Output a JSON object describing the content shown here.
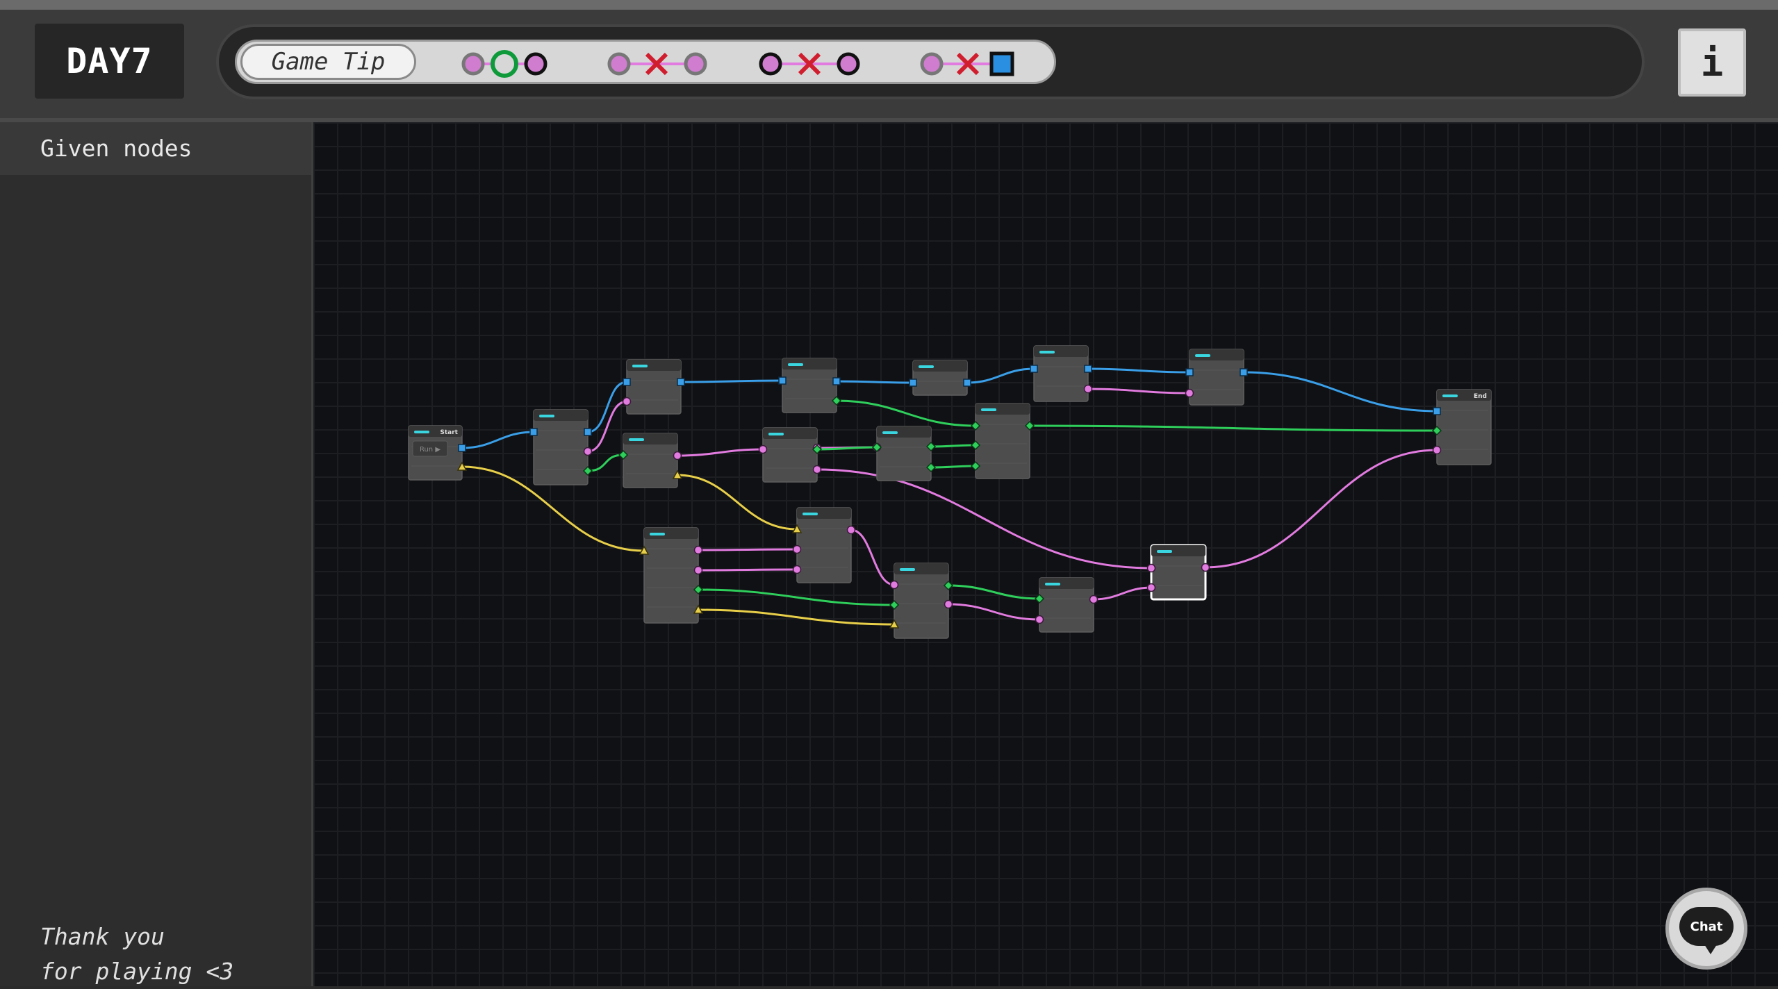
{
  "header": {
    "day_label": "DAY7",
    "tip_label": "Game Tip",
    "info_label": "i",
    "tip_legend": [
      {
        "left": "pink",
        "middle": "green-ring",
        "right": "pink-dark"
      },
      {
        "left": "gray-pink",
        "middle": "red-cross",
        "right": "gray-pink"
      },
      {
        "left": "pink-dark",
        "middle": "red-cross",
        "right": "pink-dark"
      },
      {
        "left": "gray-pink",
        "middle": "red-cross",
        "right": "blue-square"
      }
    ]
  },
  "sidebar": {
    "header": "Given nodes",
    "footer_line1": "Thank you",
    "footer_line2": "for playing <3"
  },
  "graph": {
    "start_label": "Start",
    "end_label": "End",
    "start_button": "Run ▶",
    "colors": {
      "blue": "#3a9fe8",
      "pink": "#e27be0",
      "green": "#2fcf5c",
      "yellow": "#e8cf4a",
      "node": "#4d4d4d",
      "node_header": "#353535",
      "accent": "#3ad6e0"
    }
  },
  "chat": {
    "label": "Chat"
  }
}
